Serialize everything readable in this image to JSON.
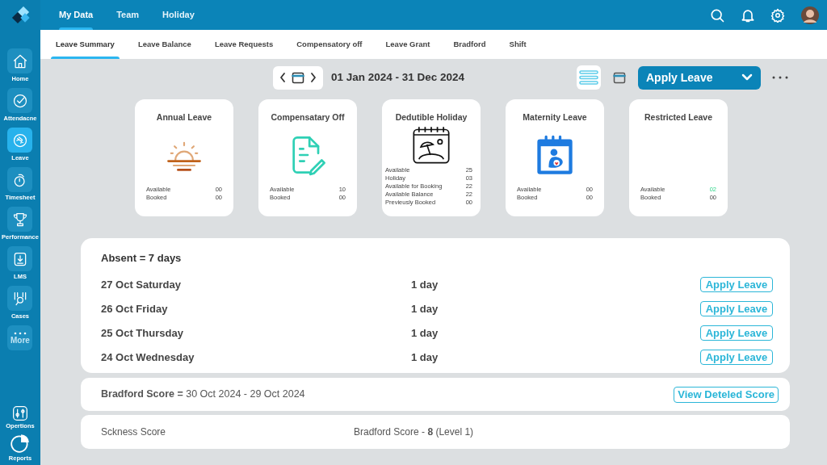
{
  "sidebar": {
    "items": [
      {
        "kind": "home",
        "label": "Home",
        "selected": false
      },
      {
        "kind": "check",
        "label": "Attendacne",
        "selected": false
      },
      {
        "kind": "plane",
        "label": "Leave",
        "selected": true
      },
      {
        "kind": "timer",
        "label": "Timesheet",
        "selected": false
      },
      {
        "kind": "trophy",
        "label": "Performance",
        "selected": false
      },
      {
        "kind": "download",
        "label": "LMS",
        "selected": false
      },
      {
        "kind": "cases",
        "label": "Cases",
        "selected": false
      },
      {
        "kind": "more",
        "label": "More",
        "selected": false
      }
    ],
    "bottom_items": [
      {
        "kind": "sliders",
        "label": "Opertions"
      },
      {
        "kind": "pie",
        "label": "Reports"
      }
    ]
  },
  "top_tabs": [
    {
      "label": "My Data",
      "selected": true
    },
    {
      "label": "Team",
      "selected": false
    },
    {
      "label": "Holiday",
      "selected": false
    }
  ],
  "sub_tabs": [
    {
      "label": "Leave Summary",
      "selected": true
    },
    {
      "label": "Leave Balance",
      "selected": false
    },
    {
      "label": "Leave Requests",
      "selected": false
    },
    {
      "label": "Compensatory off",
      "selected": false
    },
    {
      "label": "Leave Grant",
      "selected": false
    },
    {
      "label": "Bradford",
      "selected": false
    },
    {
      "label": "Shift",
      "selected": false
    }
  ],
  "toolbar": {
    "date_range": "01 Jan 2024 - 31 Dec 2024",
    "views": [
      {
        "kind": "list",
        "selected": true
      },
      {
        "kind": "calendar",
        "selected": false
      }
    ],
    "apply_button": "Apply Leave"
  },
  "leave_cards": [
    {
      "title": "Annual Leave",
      "kind": "sun",
      "stats": [
        {
          "label": "Available",
          "value": "00",
          "highlight": false
        },
        {
          "label": "Booked",
          "value": "00",
          "highlight": false
        }
      ]
    },
    {
      "title": "Compensatary Off",
      "kind": "document",
      "stats": [
        {
          "label": "Available",
          "value": "10",
          "highlight": false
        },
        {
          "label": "Booked",
          "value": "00",
          "highlight": false
        }
      ]
    },
    {
      "title": "Dedutible Holiday",
      "kind": "beach",
      "stats": [
        {
          "label": "Available",
          "value": "25",
          "highlight": false
        },
        {
          "label": "Holiday",
          "value": "03",
          "highlight": false
        },
        {
          "label": "Available for Booking",
          "value": "22",
          "highlight": false
        },
        {
          "label": "Available Balance",
          "value": "22",
          "highlight": false
        },
        {
          "label": "Previeusly Booked",
          "value": "00",
          "highlight": false
        }
      ]
    },
    {
      "title": "Maternity Leave",
      "kind": "maternity",
      "stats": [
        {
          "label": "Available",
          "value": "00",
          "highlight": false
        },
        {
          "label": "Booked",
          "value": "00",
          "highlight": false
        }
      ]
    },
    {
      "title": "Restricted Leave",
      "kind": "none",
      "stats": [
        {
          "label": "Available",
          "value": "02",
          "highlight": true
        },
        {
          "label": "Booked",
          "value": "00",
          "highlight": false
        }
      ]
    }
  ],
  "absent": {
    "title": "Absent = 7 days",
    "rows": [
      {
        "date": "27 Oct Saturday",
        "duration": "1 day",
        "action": "Apply Leave"
      },
      {
        "date": "26 Oct Friday",
        "duration": "1 day",
        "action": "Apply Leave"
      },
      {
        "date": "25 Oct Thursday",
        "duration": "1 day",
        "action": "Apply Leave"
      },
      {
        "date": "24 Oct Wednesday",
        "duration": "1 day",
        "action": "Apply Leave"
      }
    ]
  },
  "bradford": {
    "text": "**Bradford Score =** 30 Oct 2024 - 29 Oct 2024",
    "button": "View Deteled Score"
  },
  "sickness": {
    "label": "Sckness Score",
    "score": "Bradford Score - **8** (Level 1)"
  }
}
